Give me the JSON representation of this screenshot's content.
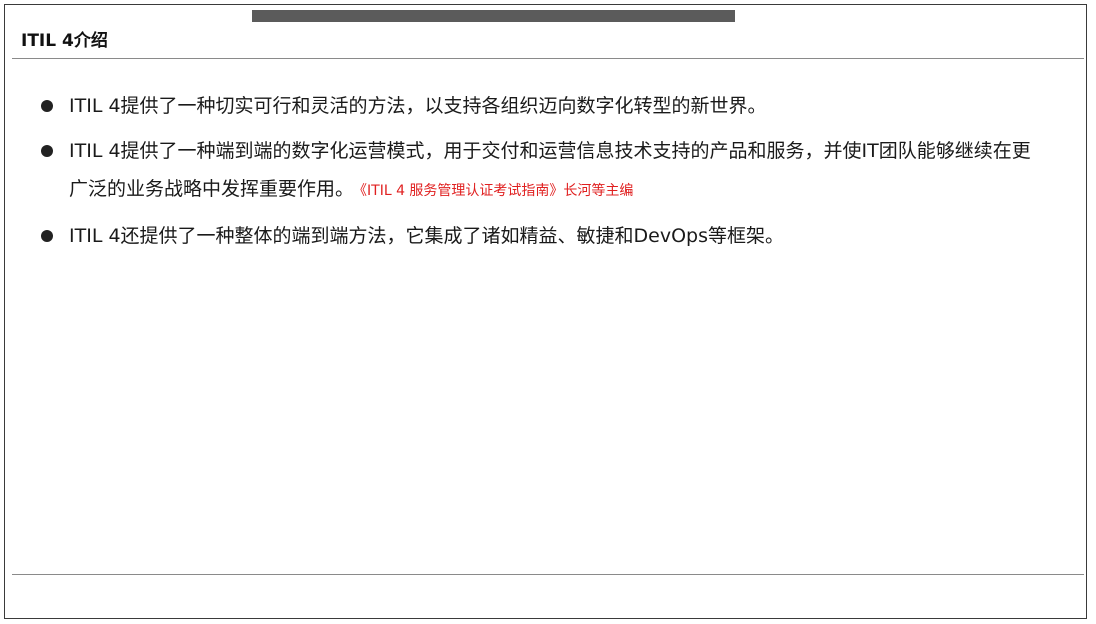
{
  "slide": {
    "title": "ITIL 4介绍",
    "bullets": [
      {
        "text": "ITIL 4提供了一种切实可行和灵活的方法，以支持各组织迈向数字化转型的新世界。",
        "citation": ""
      },
      {
        "text": "ITIL 4提供了一种端到端的数字化运营模式，用于交付和运营信息技术支持的产品和服务，并使IT团队能够继续在更广泛的业务战略中发挥重要作用。",
        "citation": "《ITIL 4 服务管理认证考试指南》长河等主编"
      },
      {
        "text": "ITIL 4还提供了一种整体的端到端方法，它集成了诸如精益、敏捷和DevOps等框架。",
        "citation": ""
      }
    ]
  },
  "colors": {
    "citation": "#e02020",
    "top_bar": "#5b5b5b",
    "text": "#1a1a1a"
  },
  "icons": {
    "bullet": "filled-circle"
  }
}
